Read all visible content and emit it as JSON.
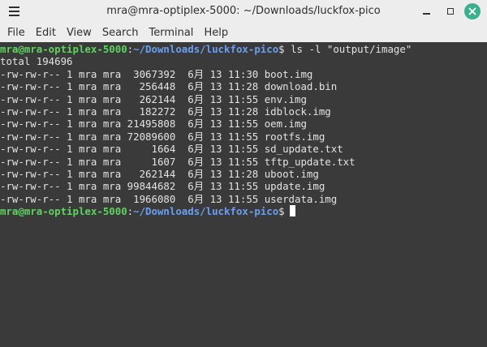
{
  "window": {
    "title": "mra@mra-optiplex-5000: ~/Downloads/luckfox-pico",
    "close_color": "#3bb08f"
  },
  "menubar": {
    "items": [
      "File",
      "Edit",
      "View",
      "Search",
      "Terminal",
      "Help"
    ]
  },
  "terminal": {
    "prompt": {
      "user_host": "mra@mra-optiplex-5000",
      "separator": ":",
      "path": "~/Downloads/luckfox-pico",
      "symbol": "$"
    },
    "command": " ls -l \"output/image\"",
    "total_line": "total 194696",
    "files": [
      {
        "perms": "-rw-rw-r--",
        "links": "1",
        "owner": "mra",
        "group": "mra",
        "size": "3067392",
        "month": "6月",
        "day": "13",
        "time": "11:30",
        "name": "boot.img"
      },
      {
        "perms": "-rw-rw-r--",
        "links": "1",
        "owner": "mra",
        "group": "mra",
        "size": "256448",
        "month": "6月",
        "day": "13",
        "time": "11:28",
        "name": "download.bin"
      },
      {
        "perms": "-rw-rw-r--",
        "links": "1",
        "owner": "mra",
        "group": "mra",
        "size": "262144",
        "month": "6月",
        "day": "13",
        "time": "11:55",
        "name": "env.img"
      },
      {
        "perms": "-rw-rw-r--",
        "links": "1",
        "owner": "mra",
        "group": "mra",
        "size": "182272",
        "month": "6月",
        "day": "13",
        "time": "11:28",
        "name": "idblock.img"
      },
      {
        "perms": "-rw-rw-r--",
        "links": "1",
        "owner": "mra",
        "group": "mra",
        "size": "21495808",
        "month": "6月",
        "day": "13",
        "time": "11:55",
        "name": "oem.img"
      },
      {
        "perms": "-rw-rw-r--",
        "links": "1",
        "owner": "mra",
        "group": "mra",
        "size": "72089600",
        "month": "6月",
        "day": "13",
        "time": "11:55",
        "name": "rootfs.img"
      },
      {
        "perms": "-rw-rw-r--",
        "links": "1",
        "owner": "mra",
        "group": "mra",
        "size": "1664",
        "month": "6月",
        "day": "13",
        "time": "11:55",
        "name": "sd_update.txt"
      },
      {
        "perms": "-rw-rw-r--",
        "links": "1",
        "owner": "mra",
        "group": "mra",
        "size": "1607",
        "month": "6月",
        "day": "13",
        "time": "11:55",
        "name": "tftp_update.txt"
      },
      {
        "perms": "-rw-rw-r--",
        "links": "1",
        "owner": "mra",
        "group": "mra",
        "size": "262144",
        "month": "6月",
        "day": "13",
        "time": "11:28",
        "name": "uboot.img"
      },
      {
        "perms": "-rw-rw-r--",
        "links": "1",
        "owner": "mra",
        "group": "mra",
        "size": "99844682",
        "month": "6月",
        "day": "13",
        "time": "11:55",
        "name": "update.img"
      },
      {
        "perms": "-rw-rw-r--",
        "links": "1",
        "owner": "mra",
        "group": "mra",
        "size": "1966080",
        "month": "6月",
        "day": "13",
        "time": "11:55",
        "name": "userdata.img"
      }
    ],
    "colors": {
      "background": "#3a3a3a",
      "text": "#e3e3e3",
      "prompt_user": "#5fd35f",
      "prompt_path": "#6a9ff0"
    }
  }
}
